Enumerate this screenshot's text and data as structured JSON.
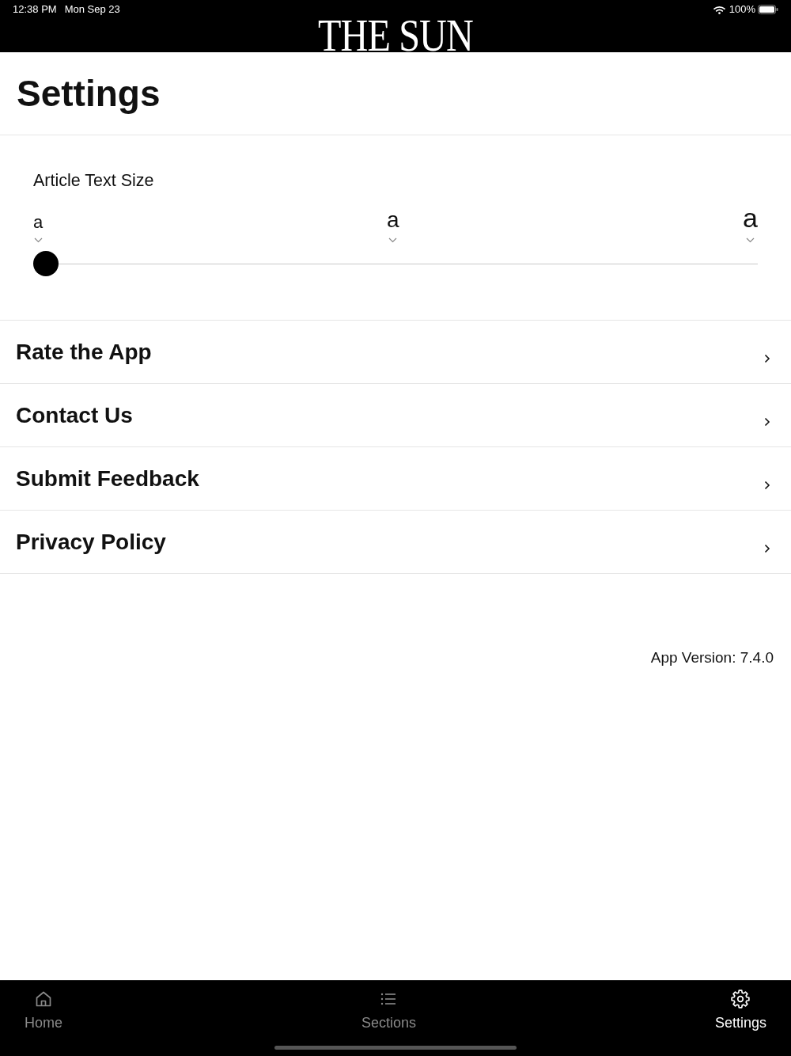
{
  "status_bar": {
    "time": "12:38 PM",
    "date": "Mon Sep 23",
    "battery": "100%"
  },
  "header": {
    "logo": "THE SUN"
  },
  "page": {
    "title": "Settings"
  },
  "text_size": {
    "label": "Article Text Size",
    "stops": [
      "a",
      "a",
      "a"
    ],
    "level": 0
  },
  "menu_items": [
    "Rate the App",
    "Contact Us",
    "Submit Feedback",
    "Privacy Policy"
  ],
  "app_version": "App Version: 7.4.0",
  "tab_bar": [
    {
      "label": "Home",
      "selected": false
    },
    {
      "label": "Sections",
      "selected": false
    },
    {
      "label": "Settings",
      "selected": true
    }
  ]
}
